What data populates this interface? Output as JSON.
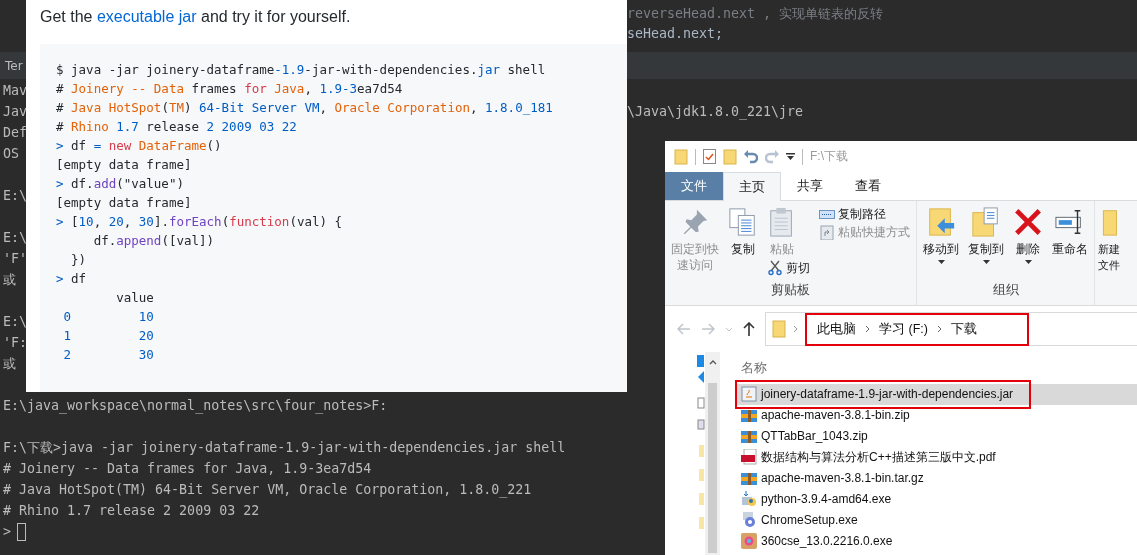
{
  "editor": {
    "lines": [
      "reverseHead.next , 实现单链表的反转",
      "seHead.next;"
    ]
  },
  "terminal": {
    "tab": "Ter",
    "lines": [
      {
        "kind": "output",
        "text": "Mav"
      },
      {
        "kind": "output",
        "text": "Jav",
        "tail": "\\Java\\jdk1.8.0_221\\jre"
      },
      {
        "kind": "output",
        "text": "Def"
      },
      {
        "kind": "output",
        "text": "OS"
      },
      {
        "kind": "blank"
      },
      {
        "kind": "output",
        "text": "E:\\"
      },
      {
        "kind": "blank"
      },
      {
        "kind": "output",
        "text": "E:\\"
      },
      {
        "kind": "output",
        "text": "'F'"
      },
      {
        "kind": "output",
        "text": "或"
      },
      {
        "kind": "blank"
      },
      {
        "kind": "output",
        "text": "E:\\"
      },
      {
        "kind": "output",
        "text": "'F:"
      },
      {
        "kind": "output",
        "text": "或"
      },
      {
        "kind": "blank"
      },
      {
        "kind": "output",
        "text": "E:\\java_workspace\\normal_notes\\src\\four_notes>F:"
      },
      {
        "kind": "blank"
      },
      {
        "kind": "output",
        "text": "F:\\下载>java -jar joinery-dataframe-1.9-jar-with-dependencies.jar shell"
      },
      {
        "kind": "output",
        "text": "# Joinery -- Data frames for Java, 1.9-3ea7d54"
      },
      {
        "kind": "output",
        "text": "# Java HotSpot(TM) 64-Bit Server VM, Oracle Corporation, 1.8.0_221"
      },
      {
        "kind": "output",
        "text": "# Rhino 1.7 release 2 2009 03 22"
      },
      {
        "kind": "prompt",
        "text": ">"
      }
    ]
  },
  "snippet": {
    "intro": {
      "before": "Get the ",
      "link": "executable jar",
      "after": " and try it for yourself."
    },
    "code": [
      [
        {
          "text": "$ java -jar joinery-dataframe",
          "kind": "text"
        },
        {
          "text": "-1.9",
          "kind": "number"
        },
        {
          "text": "-jar-with-dependencies.",
          "kind": "text"
        },
        {
          "text": "jar",
          "kind": "number"
        },
        {
          "text": " shell",
          "kind": "text"
        }
      ],
      [
        {
          "text": "# ",
          "kind": "text"
        },
        {
          "text": "Joinery -- Data",
          "kind": "name"
        },
        {
          "text": " frames ",
          "kind": "text"
        },
        {
          "text": "for",
          "kind": "keyword"
        },
        {
          "text": " Java",
          "kind": "name"
        },
        {
          "text": ", ",
          "kind": "text"
        },
        {
          "text": "1.9-3",
          "kind": "number"
        },
        {
          "text": "ea7d54",
          "kind": "text"
        }
      ],
      [
        {
          "text": "# ",
          "kind": "text"
        },
        {
          "text": "Java HotSpot",
          "kind": "name"
        },
        {
          "text": "(",
          "kind": "text"
        },
        {
          "text": "TM",
          "kind": "name"
        },
        {
          "text": ") ",
          "kind": "text"
        },
        {
          "text": "64-Bit Server VM",
          "kind": "number"
        },
        {
          "text": ", ",
          "kind": "text"
        },
        {
          "text": "Oracle Corporation",
          "kind": "name"
        },
        {
          "text": ", ",
          "kind": "text"
        },
        {
          "text": "1.8.0_181",
          "kind": "number"
        }
      ],
      [
        {
          "text": "# ",
          "kind": "text"
        },
        {
          "text": "Rhino",
          "kind": "name"
        },
        {
          "text": " 1.7",
          "kind": "number"
        },
        {
          "text": " release ",
          "kind": "text"
        },
        {
          "text": "2 2009 03 22",
          "kind": "number"
        }
      ],
      [
        {
          "text": ">",
          "kind": "prompt"
        },
        {
          "text": " df ",
          "kind": "text"
        },
        {
          "text": "=",
          "kind": "prompt"
        },
        {
          "text": " new",
          "kind": "keyword"
        },
        {
          "text": " DataFrame",
          "kind": "name"
        },
        {
          "text": "()",
          "kind": "text"
        }
      ],
      [
        {
          "text": "[empty data frame]",
          "kind": "text"
        }
      ],
      [
        {
          "text": ">",
          "kind": "prompt"
        },
        {
          "text": " df.",
          "kind": "text"
        },
        {
          "text": "add",
          "kind": "method"
        },
        {
          "text": "(\"value\")",
          "kind": "text"
        }
      ],
      [
        {
          "text": "[empty data frame]",
          "kind": "text"
        }
      ],
      [
        {
          "text": ">",
          "kind": "prompt"
        },
        {
          "text": " [",
          "kind": "text"
        },
        {
          "text": "10",
          "kind": "number"
        },
        {
          "text": ", ",
          "kind": "text"
        },
        {
          "text": "20",
          "kind": "number"
        },
        {
          "text": ", ",
          "kind": "text"
        },
        {
          "text": "30",
          "kind": "number"
        },
        {
          "text": "].",
          "kind": "text"
        },
        {
          "text": "forEach",
          "kind": "method"
        },
        {
          "text": "(",
          "kind": "text"
        },
        {
          "text": "function",
          "kind": "keyword"
        },
        {
          "text": "(val) {",
          "kind": "text"
        }
      ],
      [
        {
          "text": "     df.",
          "kind": "text"
        },
        {
          "text": "append",
          "kind": "method"
        },
        {
          "text": "([val])",
          "kind": "text"
        }
      ],
      [
        {
          "text": "  })",
          "kind": "text"
        }
      ],
      [
        {
          "text": ">",
          "kind": "prompt"
        },
        {
          "text": " df",
          "kind": "text"
        }
      ],
      [
        {
          "text": "        value",
          "kind": "text"
        }
      ],
      [
        {
          "text": " 0         10",
          "kind": "number"
        }
      ],
      [
        {
          "text": " 1         20",
          "kind": "number"
        }
      ],
      [
        {
          "text": " 2         30",
          "kind": "number"
        }
      ]
    ]
  },
  "explorer": {
    "title": "F:\\下载",
    "tabs": [
      {
        "label": "文件",
        "kind": "file",
        "selected": false
      },
      {
        "label": "主页",
        "kind": "tab",
        "selected": true
      },
      {
        "label": "共享",
        "kind": "tab",
        "selected": false
      },
      {
        "label": "查看",
        "kind": "tab",
        "selected": false
      }
    ],
    "ribbon": [
      {
        "label": "剪贴板",
        "columns": [
          [
            {
              "label": "固定到快速访问",
              "kind": "large",
              "disabled": true,
              "dropdown": false
            }
          ],
          [
            {
              "label": "复制",
              "kind": "large",
              "disabled": false,
              "dropdown": false
            }
          ],
          [
            {
              "label": "粘贴",
              "kind": "large",
              "disabled": true,
              "dropdown": false
            },
            {
              "label": "剪切",
              "kind": "small",
              "disabled": false,
              "dropdown": false
            }
          ],
          [
            {
              "label": "复制路径",
              "kind": "small",
              "disabled": false,
              "dropdown": false
            },
            {
              "label": "粘贴快捷方式",
              "kind": "small",
              "disabled": true,
              "dropdown": false
            }
          ]
        ]
      },
      {
        "label": "组织",
        "columns": [
          [
            {
              "label": "移动到",
              "kind": "large",
              "disabled": false,
              "dropdown": true
            }
          ],
          [
            {
              "label": "复制到",
              "kind": "large",
              "disabled": false,
              "dropdown": true
            }
          ],
          [
            {
              "label": "删除",
              "kind": "large",
              "disabled": false,
              "dropdown": true
            }
          ],
          [
            {
              "label": "重命名",
              "kind": "large",
              "disabled": false,
              "dropdown": false
            }
          ]
        ]
      },
      {
        "columns": [
          [
            {
              "label": "新建文件",
              "kind": "large",
              "disabled": false,
              "dropdown": false
            }
          ]
        ]
      }
    ],
    "address": {
      "highlighted": true,
      "crumbs": [
        "此电脑",
        "学习 (F:)",
        "下载"
      ]
    },
    "list": {
      "header": "名称",
      "files": [
        {
          "name": "joinery-dataframe-1.9-jar-with-dependencies.jar",
          "selected": true,
          "highlighted": true
        },
        {
          "name": "apache-maven-3.8.1-bin.zip",
          "selected": false,
          "highlighted": false
        },
        {
          "name": "QTTabBar_1043.zip",
          "selected": false,
          "highlighted": false
        },
        {
          "name": "数据结构与算法分析C++描述第三版中文.pdf",
          "selected": false,
          "highlighted": false
        },
        {
          "name": "apache-maven-3.8.1-bin.tar.gz",
          "selected": false,
          "highlighted": false
        },
        {
          "name": "python-3.9.4-amd64.exe",
          "selected": false,
          "highlighted": false
        },
        {
          "name": "ChromeSetup.exe",
          "selected": false,
          "highlighted": false
        },
        {
          "name": "360cse_13.0.2216.0.exe",
          "selected": false,
          "highlighted": false
        }
      ]
    }
  }
}
